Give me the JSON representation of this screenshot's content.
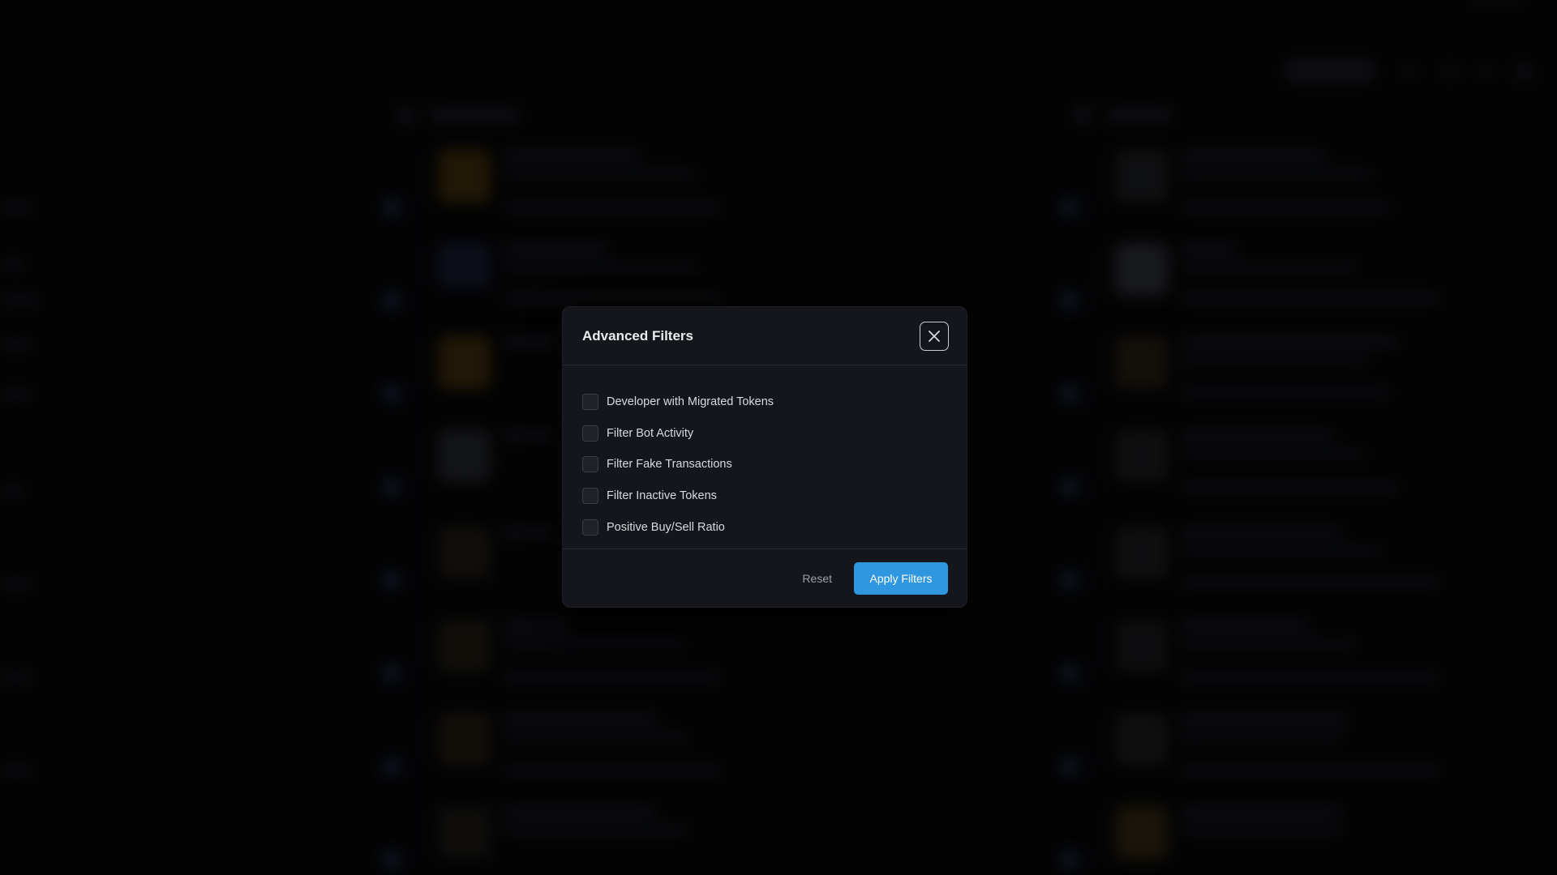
{
  "modal": {
    "title": "Advanced Filters",
    "close_icon": "close-icon",
    "options": [
      {
        "label": "Developer with Migrated Tokens",
        "checked": false
      },
      {
        "label": "Filter Bot Activity",
        "checked": false
      },
      {
        "label": "Filter Fake Transactions",
        "checked": false
      },
      {
        "label": "Filter Inactive Tokens",
        "checked": false
      },
      {
        "label": "Positive Buy/Sell Ratio",
        "checked": false
      }
    ],
    "reset_label": "Reset",
    "apply_label": "Apply Filters"
  },
  "colors": {
    "accent": "#2f97e0",
    "modal_bg": "#14161b",
    "backdrop": "#030304"
  }
}
